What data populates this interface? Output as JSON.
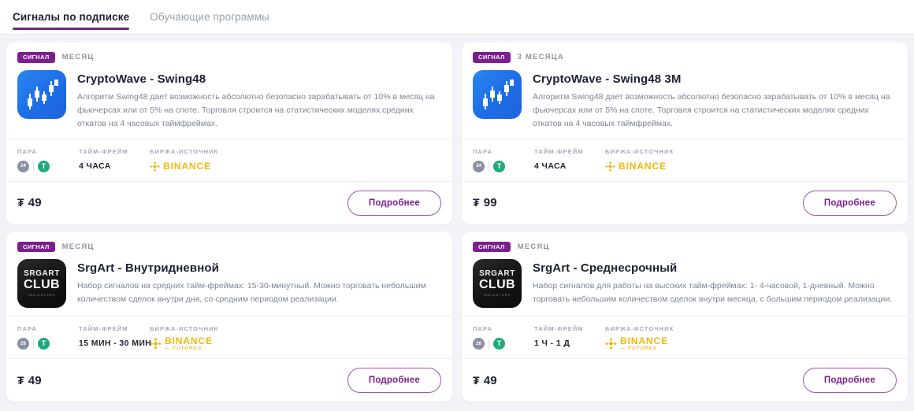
{
  "tabs": [
    {
      "label": "Сигналы по подписке",
      "active": true
    },
    {
      "label": "Обучающие программы",
      "active": false
    }
  ],
  "labels": {
    "pair": "ПАРА",
    "timeframe": "ТАЙМ-ФРЕЙМ",
    "exchange": "БИРЖА-ИСТОЧНИК",
    "signal_badge": "СИГНАЛ",
    "details_button": "Подробнее",
    "currency_symbol": "₮"
  },
  "cards": [
    {
      "badge": "СИГНАЛ",
      "period": "МЕСЯЦ",
      "logo_type": "cryptowave",
      "logo_text_top": "",
      "logo_text_mid": "",
      "logo_text_sub": "",
      "title": "CryptoWave - Swing48",
      "description": "Алгоритм Swing48 дает возможность абсолютно безопасно зарабатывать от 10% в месяц на фьючерсах или от 5% на споте. Торговля строится на статистических моделях средних откатов на 4 часовых таймфреймах.",
      "pair_left": "24",
      "pair_right": "T",
      "timeframe": "4 ЧАСА",
      "exchange_name": "BINANCE",
      "exchange_sub": "",
      "price_currency": "₮",
      "price_value": "49",
      "button": "Подробнее"
    },
    {
      "badge": "СИГНАЛ",
      "period": "3 МЕСЯЦА",
      "logo_type": "cryptowave",
      "logo_text_top": "",
      "logo_text_mid": "",
      "logo_text_sub": "",
      "title": "CryptoWave - Swing48 3M",
      "description": "Алгоритм Swing48 дает возможность абсолютно безопасно зарабатывать от 10% в месяц на фьючерсах или от 5% на споте. Торговля строится на статистических моделях средних откатов на 4 часовых таймфреймах.",
      "pair_left": "24",
      "pair_right": "T",
      "timeframe": "4 ЧАСА",
      "exchange_name": "BINANCE",
      "exchange_sub": "",
      "price_currency": "₮",
      "price_value": "99",
      "button": "Подробнее"
    },
    {
      "badge": "СИГНАЛ",
      "period": "МЕСЯЦ",
      "logo_type": "srgart",
      "logo_text_top": "SRGART",
      "logo_text_mid": "CLUB",
      "logo_text_sub": "INDICATORS",
      "title": "SrgArt - Внутридневной",
      "description": "Набор сигналов на средних тайм-фреймах: 15-30-минутный. Можно торговать небольшим количеством сделок внутри дня, со средним периодом реализации.",
      "pair_left": "26",
      "pair_right": "T",
      "timeframe": "15 МИН - 30 МИН",
      "exchange_name": "BINANCE",
      "exchange_sub": "— FUTURES",
      "price_currency": "₮",
      "price_value": "49",
      "button": "Подробнее"
    },
    {
      "badge": "СИГНАЛ",
      "period": "МЕСЯЦ",
      "logo_type": "srgart",
      "logo_text_top": "SRGART",
      "logo_text_mid": "CLUB",
      "logo_text_sub": "INDICATORS",
      "title": "SrgArt - Среднесрочный",
      "description": "Набор сигналов для работы на высоких тайм-фреймах: 1- 4-часовой, 1-дневный. Можно торговать небольшим количеством сделок внутри месяца, с большим периодом реализации.",
      "pair_left": "26",
      "pair_right": "T",
      "timeframe": "1 Ч - 1 Д",
      "exchange_name": "BINANCE",
      "exchange_sub": "— FUTURES",
      "price_currency": "₮",
      "price_value": "49",
      "button": "Подробнее"
    }
  ],
  "colors": {
    "accent_purple": "#7b1f8f",
    "badge_purple": "#7b1f8f",
    "binance_yellow": "#f0b90b",
    "tether_green": "#1fa97c",
    "page_bg": "#f2f3f7"
  }
}
